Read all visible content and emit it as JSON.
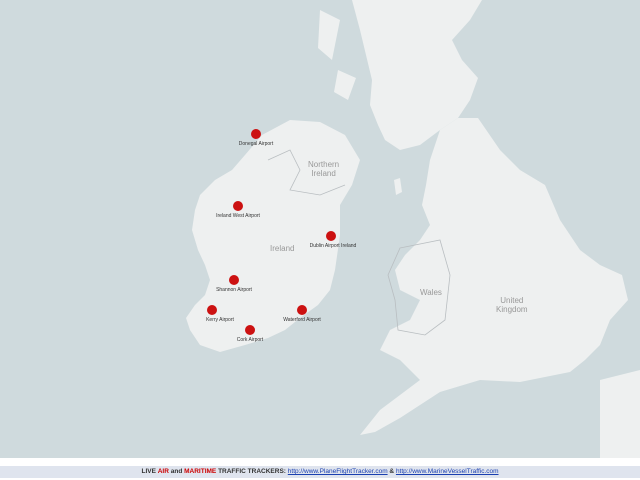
{
  "map": {
    "colors": {
      "sea": "#cfdadd",
      "land": "#eef0f0",
      "border": "#b9bec1",
      "marker": "#cc1111"
    },
    "regions": {
      "northern_ireland": [
        "Northern",
        "Ireland"
      ],
      "ireland": "Ireland",
      "wales": "Wales",
      "united_kingdom": [
        "United",
        "Kingdom"
      ]
    },
    "airports": [
      {
        "name": "Donegal Airport"
      },
      {
        "name": "Ireland West Airport"
      },
      {
        "name": "Dublin Airport Ireland"
      },
      {
        "name": "Shannon Airport"
      },
      {
        "name": "Kerry Airport"
      },
      {
        "name": "Waterford Airport"
      },
      {
        "name": "Cork Airport"
      }
    ]
  },
  "footer": {
    "live": "LIVE",
    "air": "AIR",
    "and": "and",
    "maritime": "MARITIME",
    "trackers": "TRAFFIC TRACKERS:",
    "link1": "http://www.PlaneFlightTracker.com",
    "amp": "&",
    "link2": "http://www.MarineVesselTraffic.com"
  }
}
